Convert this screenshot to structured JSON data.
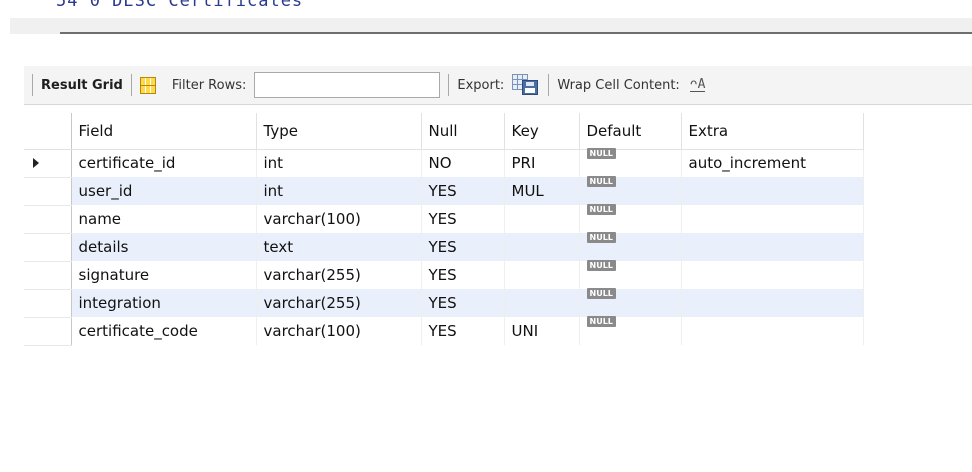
{
  "editor": {
    "partial_text": "54 0   DESC Certificates"
  },
  "toolbar": {
    "result_grid_label": "Result Grid",
    "filter_label": "Filter Rows:",
    "filter_value": "",
    "export_label": "Export:",
    "wrap_label": "Wrap Cell Content:",
    "wrap_icon": "wrap-text-icon"
  },
  "grid": {
    "columns": [
      "Field",
      "Type",
      "Null",
      "Key",
      "Default",
      "Extra"
    ],
    "null_text": "NULL",
    "rows": [
      {
        "field": "certificate_id",
        "type": "int",
        "null": "NO",
        "key": "PRI",
        "extra": "auto_increment",
        "selected": true
      },
      {
        "field": "user_id",
        "type": "int",
        "null": "YES",
        "key": "MUL",
        "extra": ""
      },
      {
        "field": "name",
        "type": "varchar(100)",
        "null": "YES",
        "key": "",
        "extra": ""
      },
      {
        "field": "details",
        "type": "text",
        "null": "YES",
        "key": "",
        "extra": ""
      },
      {
        "field": "signature",
        "type": "varchar(255)",
        "null": "YES",
        "key": "",
        "extra": ""
      },
      {
        "field": "integration",
        "type": "varchar(255)",
        "null": "YES",
        "key": "",
        "extra": ""
      },
      {
        "field": "certificate_code",
        "type": "varchar(100)",
        "null": "YES",
        "key": "UNI",
        "extra": ""
      }
    ]
  },
  "colors": {
    "alt_row": "#eaf0fb",
    "null_badge": "#8a8a8a",
    "toolbar_bg": "#f4f4f4"
  }
}
